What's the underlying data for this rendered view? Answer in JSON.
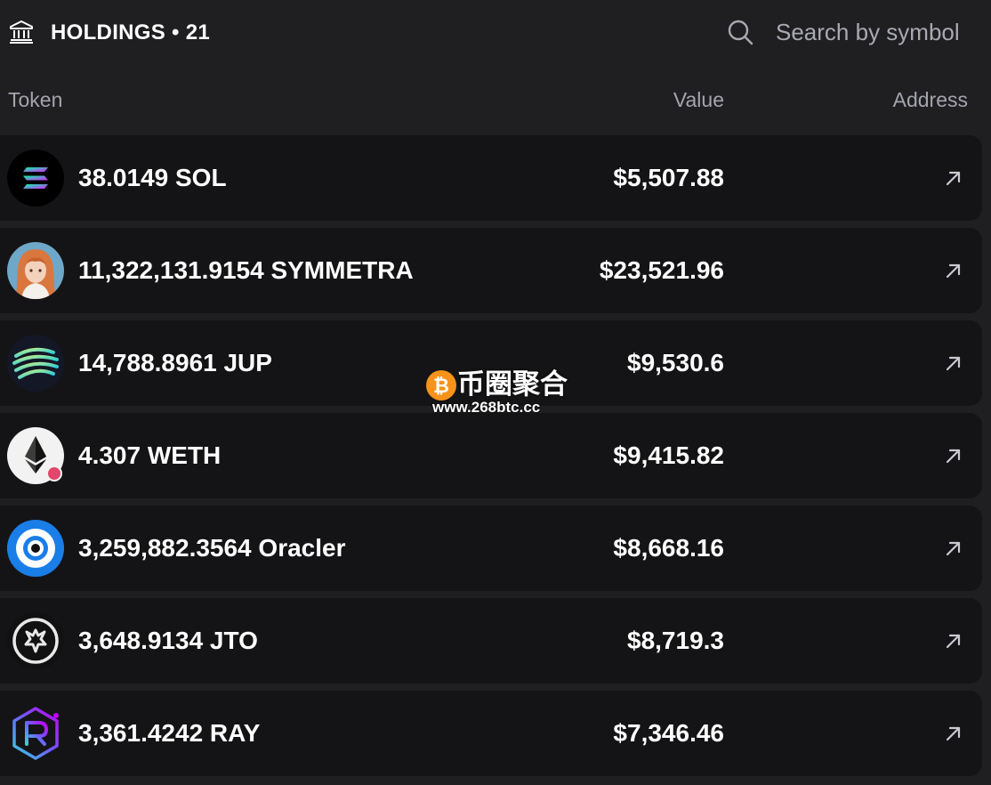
{
  "header": {
    "title": "HOLDINGS • 21",
    "search_placeholder": "Search by symbol"
  },
  "columns": {
    "token": "Token",
    "value": "Value",
    "address": "Address"
  },
  "holdings": [
    {
      "amount": "38.0149 SOL",
      "value": "$5,507.88",
      "icon": "solana-logo-icon"
    },
    {
      "amount": "11,322,131.9154 SYMMETRA",
      "value": "$23,521.96",
      "icon": "symmetra-avatar-icon"
    },
    {
      "amount": "14,788.8961 JUP",
      "value": "$9,530.6",
      "icon": "jupiter-logo-icon"
    },
    {
      "amount": "4.307 WETH",
      "value": "$9,415.82",
      "icon": "ethereum-logo-icon"
    },
    {
      "amount": "3,259,882.3564 Oracler",
      "value": "$8,668.16",
      "icon": "oracler-logo-icon"
    },
    {
      "amount": "3,648.9134 JTO",
      "value": "$8,719.3",
      "icon": "jito-logo-icon"
    },
    {
      "amount": "3,361.4242 RAY",
      "value": "$7,346.46",
      "icon": "raydium-logo-icon"
    }
  ],
  "watermark": {
    "text": "币圈聚合",
    "url": "www.268btc.cc"
  },
  "colors": {
    "background": "#1f1f22",
    "row_background": "#141416",
    "muted_text": "#a4a4ad"
  }
}
